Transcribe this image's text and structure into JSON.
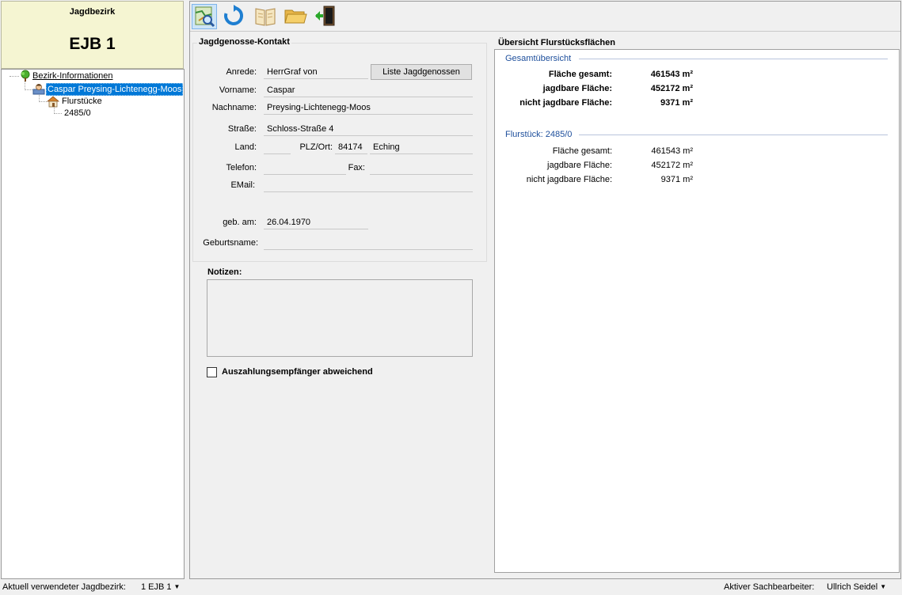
{
  "left_panel": {
    "header_label": "Jagdbezirk",
    "header_name": "EJB 1"
  },
  "tree": {
    "root": "Bezirk-Informationen",
    "owner": "Caspar Preysing-Lichtenegg-Moos",
    "flurstuecke": "Flurstücke",
    "parcel": "2485/0"
  },
  "toolbar": {
    "buttons": [
      "map-search-icon",
      "refresh-icon",
      "book-icon",
      "folder-icon",
      "exit-door-icon"
    ]
  },
  "contact": {
    "title": "Jagdgenosse-Kontakt",
    "anrede_label": "Anrede:",
    "anrede_value": "HerrGraf von",
    "list_button": "Liste Jagdgenossen",
    "vorname_label": "Vorname:",
    "vorname_value": "Caspar",
    "nachname_label": "Nachname:",
    "nachname_value": "Preysing-Lichtenegg-Moos",
    "strasse_label": "Straße:",
    "strasse_value": "Schloss-Straße 4",
    "land_label": "Land:",
    "land_value": "",
    "plz_label": "PLZ/Ort:",
    "plz_value": "84174",
    "ort_value": "Eching",
    "telefon_label": "Telefon:",
    "telefon_value": "",
    "fax_label": "Fax:",
    "fax_value": "",
    "email_label": "EMail:",
    "email_value": "",
    "geb_label": "geb. am:",
    "geb_value": "26.04.1970",
    "geburtsname_label": "Geburtsname:",
    "geburtsname_value": ""
  },
  "notes": {
    "label": "Notizen:",
    "value": ""
  },
  "payout_checkbox": {
    "label": "Auszahlungsempfänger abweichend",
    "checked": false
  },
  "overview": {
    "title": "Übersicht Flurstücksflächen",
    "total": {
      "title": "Gesamtübersicht",
      "rows": [
        {
          "label": "Fläche gesamt:",
          "value": "461543 m²"
        },
        {
          "label": "jagdbare Fläche:",
          "value": "452172 m²"
        },
        {
          "label": "nicht jagdbare Fläche:",
          "value": "9371 m²"
        }
      ]
    },
    "parcel": {
      "title": "Flurstück: 2485/0",
      "rows": [
        {
          "label": "Fläche gesamt:",
          "value": "461543 m²"
        },
        {
          "label": "jagdbare Fläche:",
          "value": "452172 m²"
        },
        {
          "label": "nicht jagdbare Fläche:",
          "value": "9371 m²"
        }
      ]
    },
    "accent_color": "#1e4f9c"
  },
  "statusbar": {
    "bezirk_label": "Aktuell verwendeter Jagdbezirk:",
    "bezirk_value": "1 EJB 1",
    "sachbearbeiter_label": "Aktiver Sachbearbeiter:",
    "sachbearbeiter_value": "Ullrich Seidel"
  }
}
